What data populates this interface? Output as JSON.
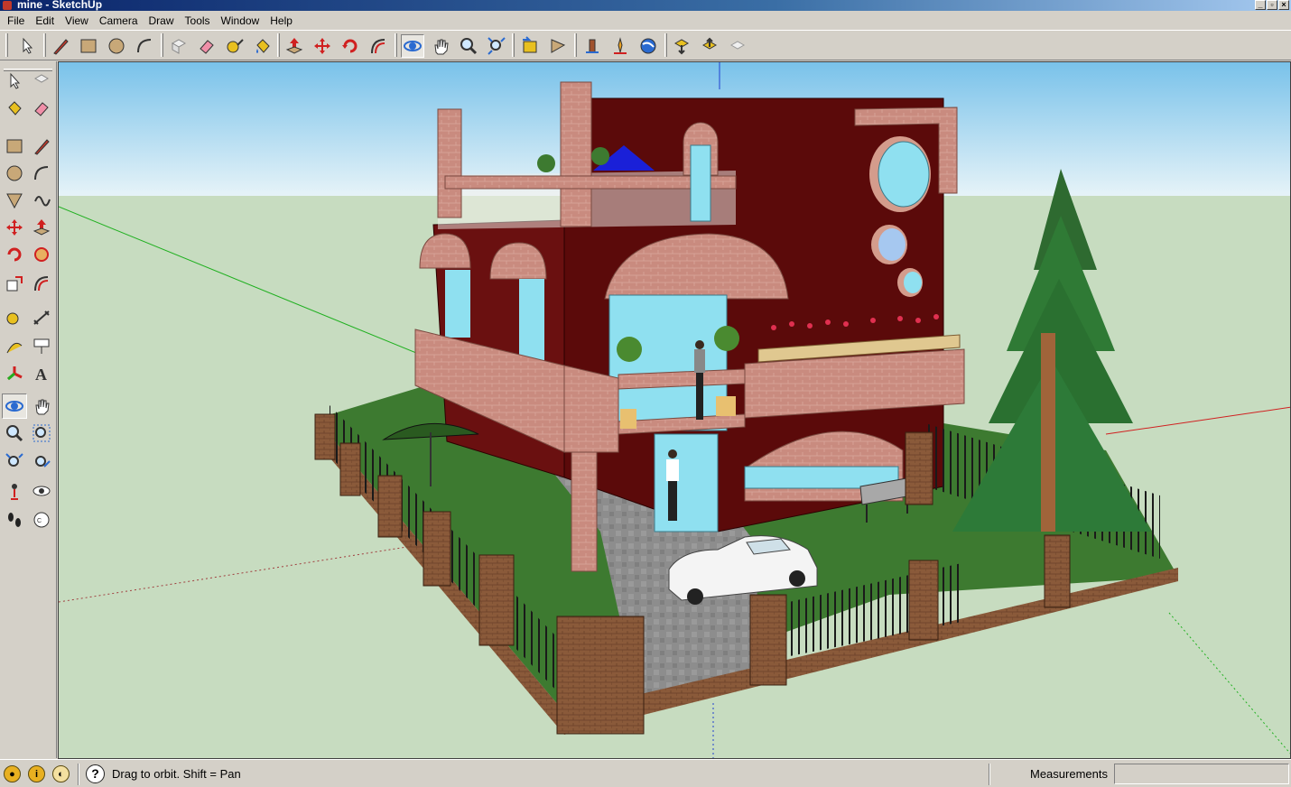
{
  "window": {
    "title": "mine - SketchUp",
    "controls": [
      "minimize",
      "restore",
      "close"
    ]
  },
  "menu": {
    "items": [
      "File",
      "Edit",
      "View",
      "Camera",
      "Draw",
      "Tools",
      "Window",
      "Help"
    ]
  },
  "toolbar": {
    "tools": [
      {
        "name": "select-icon",
        "active": false
      },
      {
        "name": "pencil-line-icon"
      },
      {
        "name": "rectangle-icon"
      },
      {
        "name": "circle-icon"
      },
      {
        "name": "arc-icon"
      },
      {
        "name": "make-component-icon"
      },
      {
        "name": "eraser-icon"
      },
      {
        "name": "tape-measure-icon"
      },
      {
        "name": "paint-bucket-icon"
      },
      {
        "name": "push-pull-icon"
      },
      {
        "name": "move-icon"
      },
      {
        "name": "rotate-icon"
      },
      {
        "name": "offset-icon"
      },
      {
        "name": "orbit-icon",
        "active": true
      },
      {
        "name": "pan-icon"
      },
      {
        "name": "zoom-icon"
      },
      {
        "name": "zoom-extents-icon"
      },
      {
        "name": "previous-view-icon"
      },
      {
        "name": "next-view-icon"
      },
      {
        "name": "add-location-icon"
      },
      {
        "name": "toggle-terrain-icon"
      },
      {
        "name": "preview-google-earth-icon"
      },
      {
        "name": "get-models-icon"
      },
      {
        "name": "share-model-icon"
      },
      {
        "name": "share-component-icon"
      }
    ]
  },
  "palette": {
    "tools": [
      "select-icon",
      "make-component-icon",
      "paint-bucket-icon",
      "eraser-icon",
      "rectangle-icon",
      "line-icon",
      "circle-icon",
      "arc-icon",
      "polygon-icon",
      "freehand-icon",
      "move-icon",
      "push-pull-icon",
      "rotate-icon",
      "follow-me-icon",
      "scale-icon",
      "offset-icon",
      "tape-measure-icon",
      "dimension-icon",
      "protractor-icon",
      "text-icon",
      "axes-icon",
      "3d-text-icon",
      "orbit-icon",
      "pan-icon",
      "zoom-icon",
      "zoom-window-icon",
      "zoom-extents-icon",
      "previous-icon",
      "position-camera-icon",
      "look-around-icon",
      "walk-icon",
      "section-plane-icon"
    ]
  },
  "status": {
    "text": "Drag to orbit.  Shift = Pan",
    "help": "?",
    "measurements_label": "Measurements",
    "measurements_value": ""
  },
  "colors": {
    "sky_top": "#7ec4e8",
    "sky_bottom": "#e8f4f8",
    "ground": "#c7dcc0",
    "building_wall": "#5b0a0a",
    "brick": "#c98b7f",
    "glass": "#8fe0f0",
    "grass": "#3d7a30",
    "paving": "#8f8f8f",
    "axis_red": "#d02020",
    "axis_green": "#20b020",
    "axis_blue": "#2040d0"
  }
}
